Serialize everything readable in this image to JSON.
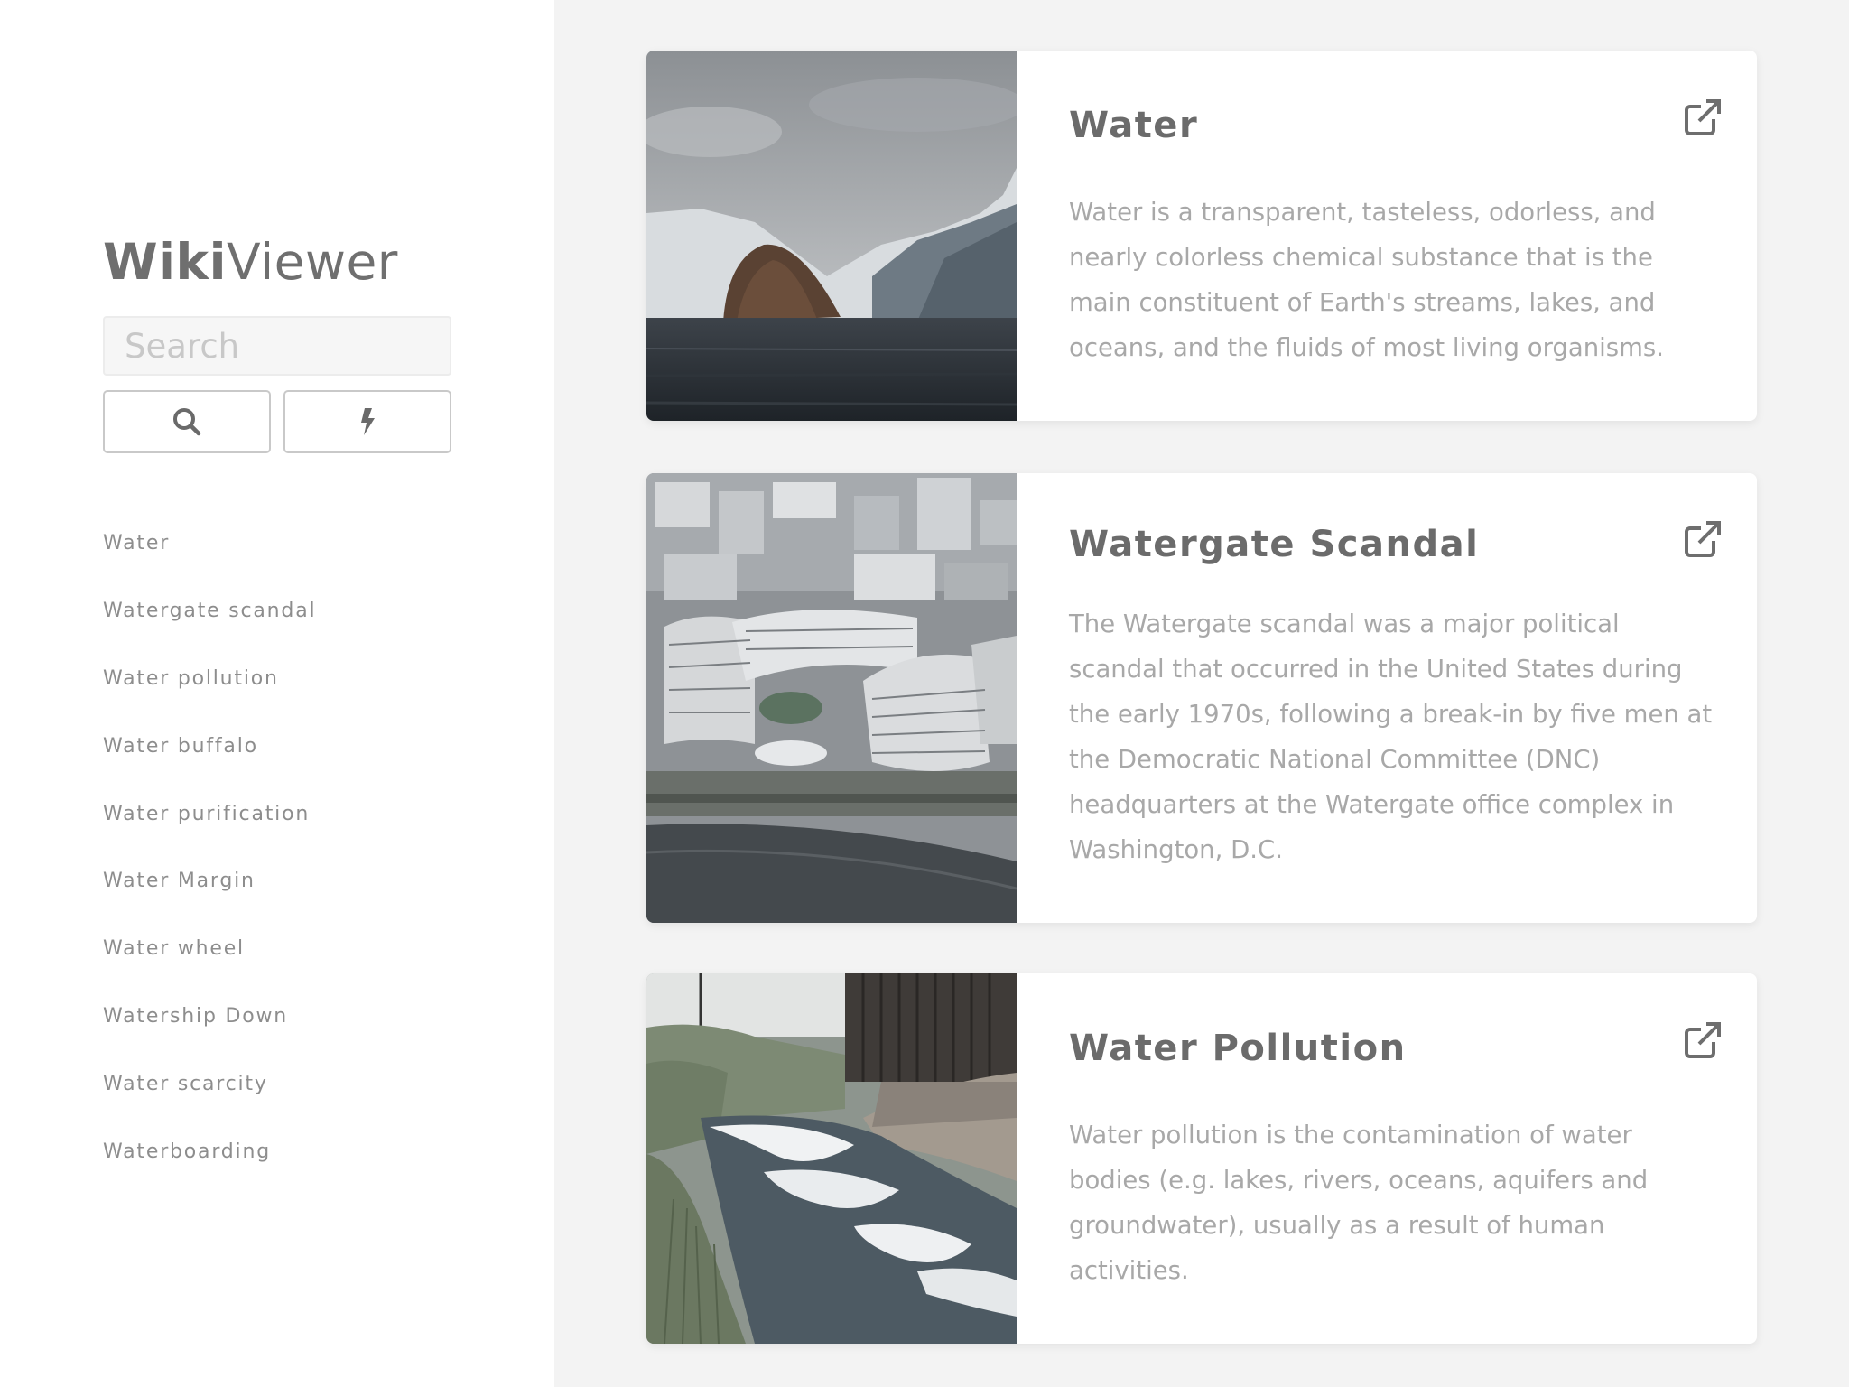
{
  "app": {
    "logo_bold": "Wiki",
    "logo_light": "Viewer"
  },
  "search": {
    "placeholder": "Search",
    "value": "",
    "search_button_icon": "search-icon",
    "random_button_icon": "lightning-icon"
  },
  "suggestions": [
    "Water",
    "Watergate scandal",
    "Water pollution",
    "Water buffalo",
    "Water purification",
    "Water Margin",
    "Water wheel",
    "Watership Down",
    "Water scarcity",
    "Waterboarding"
  ],
  "results": [
    {
      "title": "Water",
      "extract": "Water is a transparent, tasteless, odorless, and nearly colorless chemical substance that is the main constituent of Earth's streams, lakes, and oceans, and the fluids of most living organisms.",
      "image": "iceberg-photo",
      "link_icon": "external-link-icon"
    },
    {
      "title": "Watergate Scandal",
      "extract": "The Watergate scandal was a major political scandal that occurred in the United States during the early 1970s, following a break-in by five men at the Democratic National Committee (DNC) headquarters at the Watergate office complex in Washington, D.C.",
      "image": "watergate-complex-photo",
      "link_icon": "external-link-icon"
    },
    {
      "title": "Water Pollution",
      "extract": "Water pollution is the contamination of water bodies (e.g. lakes, rivers, oceans, aquifers and groundwater), usually as a result of human activities.",
      "image": "polluted-river-photo",
      "link_icon": "external-link-icon"
    }
  ]
}
